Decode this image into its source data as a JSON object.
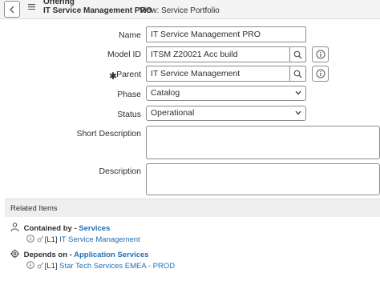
{
  "header": {
    "record_type": "Offering",
    "record_title": "IT Service Management PRO",
    "view_text": "View: Service Portfolio"
  },
  "form": {
    "name": {
      "label": "Name",
      "value": "IT Service Management PRO"
    },
    "model_id": {
      "label": "Model ID",
      "value": "ITSM Z20021 Acc build"
    },
    "parent": {
      "label": "Parent",
      "required_mark": "✱",
      "value": "IT Service Management"
    },
    "phase": {
      "label": "Phase",
      "value": "Catalog"
    },
    "status": {
      "label": "Status",
      "value": "Operational"
    },
    "short_description": {
      "label": "Short Description",
      "value": ""
    },
    "description": {
      "label": "Description",
      "value": ""
    }
  },
  "related": {
    "title": "Related Items",
    "groups": [
      {
        "icon": "hierarchy-icon",
        "relation": "Contained by",
        "separator": " - ",
        "class_name": "Services",
        "item_prefix": "[L1]",
        "item_name": "IT Service Management"
      },
      {
        "icon": "gears-icon",
        "relation": "Depends on",
        "separator": " - ",
        "class_name": "Application Services",
        "item_prefix": "[L1]",
        "item_name": "Star Tech Services EMEA - PROD"
      }
    ]
  },
  "colors": {
    "link": "#1f6fb5",
    "border": "#8c8c8c",
    "header_bg": "#f4f4f4",
    "related_bg": "#eeeeee"
  }
}
